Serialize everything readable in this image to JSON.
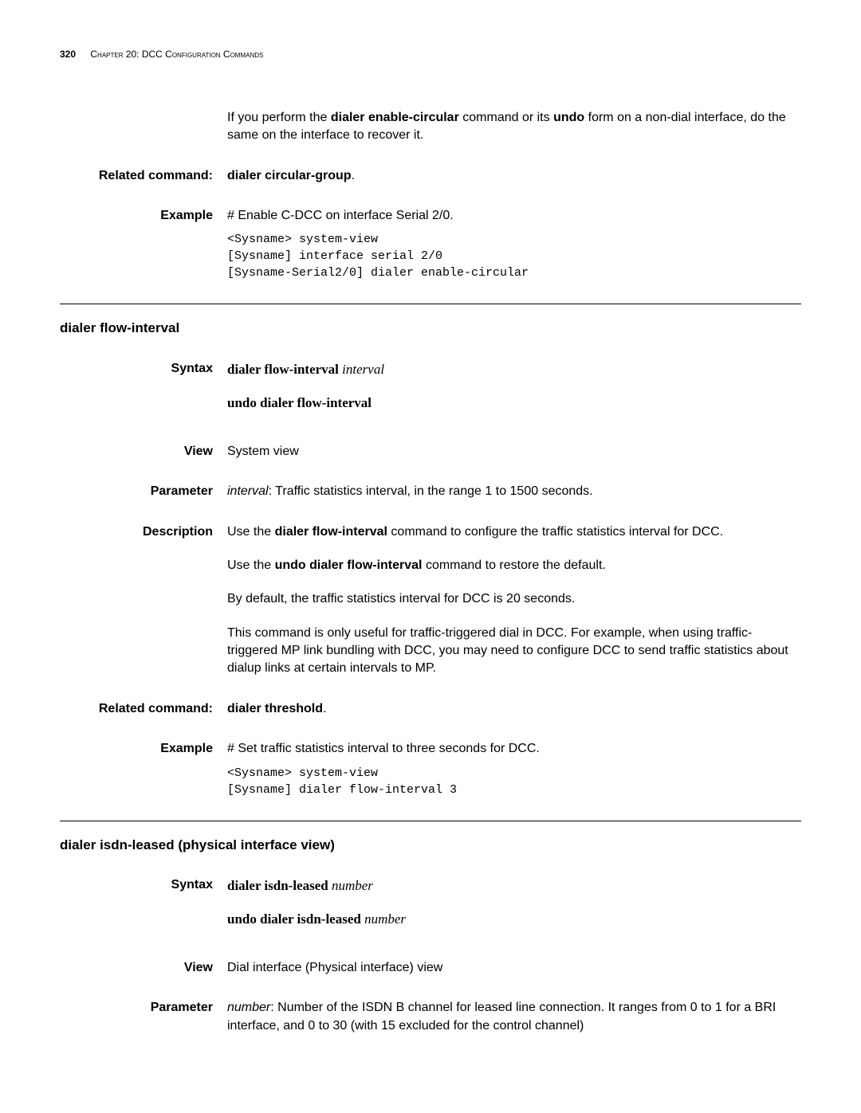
{
  "header": {
    "page_number": "320",
    "chapter": "Chapter 20: DCC Configuration Commands"
  },
  "intro": {
    "para_pre": "If you perform the ",
    "cmd1": "dialer enable-circular",
    "para_mid": " command or its ",
    "cmd2": "undo",
    "para_post": " form on a non-dial interface, do the same on the interface to recover it."
  },
  "related1": {
    "label": "Related command:",
    "value": "dialer circular-group",
    "suffix": "."
  },
  "example1": {
    "label": "Example",
    "desc": "# Enable C-DCC on interface Serial 2/0.",
    "code": "<Sysname> system-view\n[Sysname] interface serial 2/0\n[Sysname-Serial2/0] dialer enable-circular"
  },
  "section2": {
    "heading": "dialer flow-interval",
    "syntax": {
      "label": "Syntax",
      "line1_cmd": "dialer flow-interval",
      "line1_arg": " interval",
      "line2": "undo dialer flow-interval"
    },
    "view": {
      "label": "View",
      "value": "System view"
    },
    "parameter": {
      "label": "Parameter",
      "arg": "interval",
      "rest": ": Traffic statistics interval, in the range 1 to 1500 seconds."
    },
    "description": {
      "label": "Description",
      "p1_pre": "Use the ",
      "p1_cmd": "dialer flow-interval",
      "p1_post": " command to configure the traffic statistics interval for DCC.",
      "p2_pre": "Use the ",
      "p2_cmd": "undo dialer flow-interval",
      "p2_post": " command to restore the default.",
      "p3": "By default, the traffic statistics interval for DCC is 20 seconds.",
      "p4": "This command is only useful for traffic-triggered dial in DCC. For example, when using traffic-triggered MP link bundling with DCC, you may need to configure DCC to send traffic statistics about dialup links at certain intervals to MP."
    },
    "related": {
      "label": "Related command:",
      "value": "dialer threshold",
      "suffix": "."
    },
    "example": {
      "label": "Example",
      "desc": "# Set traffic statistics interval to three seconds for DCC.",
      "code": "<Sysname> system-view\n[Sysname] dialer flow-interval 3"
    }
  },
  "section3": {
    "heading": "dialer isdn-leased (physical interface view)",
    "syntax": {
      "label": "Syntax",
      "line1_cmd": "dialer isdn-leased",
      "line1_arg": " number",
      "line2_cmd": "undo dialer isdn-leased",
      "line2_arg": " number"
    },
    "view": {
      "label": "View",
      "value": "Dial interface (Physical interface) view"
    },
    "parameter": {
      "label": "Parameter",
      "arg": "number",
      "rest": ": Number of the ISDN B channel for leased line connection. It ranges from 0 to 1 for a BRI interface, and 0 to 30 (with 15 excluded for the control channel)"
    }
  }
}
